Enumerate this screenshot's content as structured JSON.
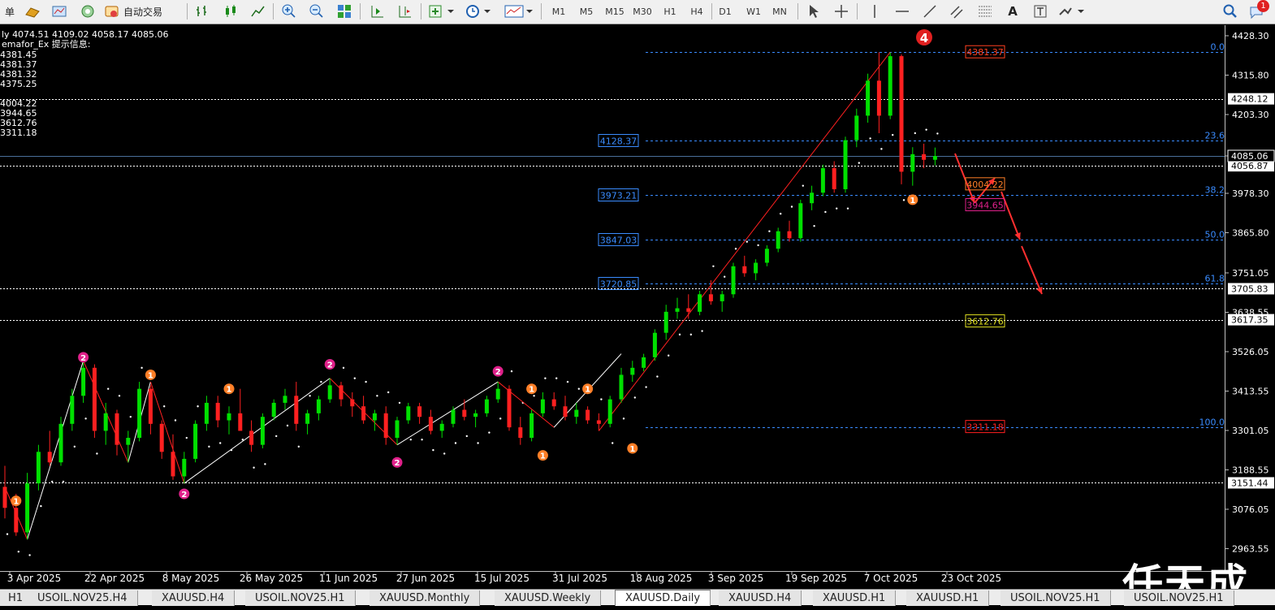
{
  "toolbar": {
    "menu_label": "单",
    "autotrade_label": "自动交易",
    "timeframes": [
      "M1",
      "M5",
      "M15",
      "M30",
      "H1",
      "H4",
      "D1",
      "W1",
      "MN"
    ],
    "text_tool_label": "A",
    "notification_count": "1"
  },
  "info": {
    "ohlc": "ly  4074.51 4109.02 4058.17 4085.06",
    "indicator_title": "emafor_Ex 提示信息:",
    "values": [
      "4381.45",
      "4381.37",
      "4381.32",
      "4375.25",
      "",
      "4004.22",
      "3944.65",
      "3612.76",
      "3311.18"
    ]
  },
  "colors": {
    "up": "#00e000",
    "down": "#ff2020",
    "fib": "#3a8cff",
    "dots": "#ffffff",
    "zigzag_up": "#ffffff",
    "zigzag_down": "#ff2020",
    "marker_orange": "#ff7f27",
    "marker_magenta": "#e0208a"
  },
  "chart_data": {
    "type": "candlestick",
    "symbol": "XAUUSD",
    "timeframe": "Daily",
    "y_range": [
      3060,
      4460
    ],
    "price_axis": [
      "4428.30",
      "4315.80",
      "4203.30",
      "4085.06",
      "3978.30",
      "3865.80",
      "3751.05",
      "3638.55",
      "3526.05",
      "3413.55",
      "3301.05",
      "3188.55",
      "3076.05",
      "2963.55"
    ],
    "hline_labels": [
      "4248.12",
      "4056.87",
      "3705.83",
      "3617.35",
      "3151.44"
    ],
    "dates": [
      "3 Apr 2025",
      "22 Apr 2025",
      "8 May 2025",
      "26 May 2025",
      "11 Jun 2025",
      "27 Jun 2025",
      "15 Jul 2025",
      "31 Jul 2025",
      "18 Aug 2025",
      "3 Sep 2025",
      "19 Sep 2025",
      "7 Oct 2025",
      "23 Oct 2025"
    ],
    "candles": [
      [
        3140,
        3200,
        3050,
        3080
      ],
      [
        3080,
        3120,
        3000,
        3010
      ],
      [
        3010,
        3180,
        2990,
        3150
      ],
      [
        3150,
        3260,
        3130,
        3240
      ],
      [
        3240,
        3300,
        3200,
        3210
      ],
      [
        3210,
        3340,
        3200,
        3320
      ],
      [
        3320,
        3420,
        3300,
        3400
      ],
      [
        3400,
        3500,
        3380,
        3480
      ],
      [
        3480,
        3490,
        3280,
        3300
      ],
      [
        3300,
        3380,
        3260,
        3350
      ],
      [
        3350,
        3360,
        3230,
        3260
      ],
      [
        3260,
        3300,
        3210,
        3280
      ],
      [
        3280,
        3440,
        3270,
        3420
      ],
      [
        3420,
        3430,
        3290,
        3320
      ],
      [
        3320,
        3330,
        3220,
        3240
      ],
      [
        3240,
        3290,
        3160,
        3170
      ],
      [
        3170,
        3240,
        3150,
        3220
      ],
      [
        3220,
        3330,
        3210,
        3320
      ],
      [
        3320,
        3400,
        3300,
        3380
      ],
      [
        3380,
        3400,
        3310,
        3330
      ],
      [
        3330,
        3370,
        3290,
        3350
      ],
      [
        3350,
        3420,
        3320,
        3300
      ],
      [
        3300,
        3330,
        3240,
        3260
      ],
      [
        3260,
        3350,
        3250,
        3340
      ],
      [
        3340,
        3390,
        3330,
        3380
      ],
      [
        3380,
        3420,
        3360,
        3400
      ],
      [
        3400,
        3440,
        3300,
        3320
      ],
      [
        3320,
        3360,
        3290,
        3350
      ],
      [
        3350,
        3400,
        3330,
        3390
      ],
      [
        3390,
        3450,
        3380,
        3430
      ],
      [
        3430,
        3440,
        3370,
        3390
      ],
      [
        3390,
        3410,
        3340,
        3370
      ],
      [
        3370,
        3400,
        3320,
        3330
      ],
      [
        3330,
        3360,
        3300,
        3350
      ],
      [
        3350,
        3370,
        3260,
        3280
      ],
      [
        3280,
        3340,
        3260,
        3330
      ],
      [
        3330,
        3380,
        3320,
        3370
      ],
      [
        3370,
        3380,
        3320,
        3340
      ],
      [
        3340,
        3360,
        3290,
        3300
      ],
      [
        3300,
        3330,
        3280,
        3320
      ],
      [
        3320,
        3370,
        3310,
        3360
      ],
      [
        3360,
        3390,
        3330,
        3340
      ],
      [
        3340,
        3360,
        3310,
        3350
      ],
      [
        3350,
        3400,
        3340,
        3390
      ],
      [
        3390,
        3440,
        3380,
        3420
      ],
      [
        3420,
        3430,
        3300,
        3310
      ],
      [
        3310,
        3340,
        3260,
        3280
      ],
      [
        3280,
        3360,
        3270,
        3350
      ],
      [
        3350,
        3410,
        3340,
        3390
      ],
      [
        3390,
        3410,
        3360,
        3370
      ],
      [
        3370,
        3400,
        3330,
        3340
      ],
      [
        3340,
        3380,
        3320,
        3360
      ],
      [
        3360,
        3370,
        3320,
        3330
      ],
      [
        3330,
        3350,
        3300,
        3320
      ],
      [
        3320,
        3400,
        3310,
        3390
      ],
      [
        3390,
        3480,
        3380,
        3460
      ],
      [
        3460,
        3500,
        3440,
        3480
      ],
      [
        3480,
        3520,
        3470,
        3510
      ],
      [
        3510,
        3590,
        3500,
        3580
      ],
      [
        3580,
        3660,
        3560,
        3640
      ],
      [
        3640,
        3680,
        3620,
        3650
      ],
      [
        3650,
        3690,
        3620,
        3640
      ],
      [
        3640,
        3700,
        3630,
        3690
      ],
      [
        3690,
        3730,
        3660,
        3670
      ],
      [
        3670,
        3700,
        3640,
        3690
      ],
      [
        3690,
        3780,
        3680,
        3770
      ],
      [
        3770,
        3800,
        3740,
        3750
      ],
      [
        3750,
        3790,
        3730,
        3780
      ],
      [
        3780,
        3830,
        3770,
        3820
      ],
      [
        3820,
        3880,
        3810,
        3870
      ],
      [
        3870,
        3900,
        3840,
        3850
      ],
      [
        3850,
        3960,
        3840,
        3950
      ],
      [
        3950,
        4000,
        3930,
        3980
      ],
      [
        3980,
        4060,
        3970,
        4050
      ],
      [
        4050,
        4070,
        3980,
        3990
      ],
      [
        3990,
        4140,
        3980,
        4130
      ],
      [
        4130,
        4220,
        4110,
        4200
      ],
      [
        4200,
        4320,
        4180,
        4300
      ],
      [
        4300,
        4381,
        4150,
        4200
      ],
      [
        4200,
        4380,
        4190,
        4370
      ],
      [
        4370,
        4375,
        4004,
        4040
      ],
      [
        4040,
        4110,
        4000,
        4090
      ],
      [
        4090,
        4120,
        4050,
        4074
      ],
      [
        4074,
        4109,
        4058,
        4085
      ]
    ],
    "fibonacci": [
      {
        "level": "0.0",
        "price": 4381.45
      },
      {
        "level": "23.6",
        "price_label": "4128.37",
        "price": 4128.37
      },
      {
        "level": "38.2",
        "price_label": "3973.21",
        "price": 3973.21
      },
      {
        "level": "50.0",
        "price_label": "3847.03",
        "price": 3847.03
      },
      {
        "level": "61.8",
        "price_label": "3720.85",
        "price": 3720.85
      },
      {
        "level": "100.0",
        "price": 3311.18
      }
    ],
    "box_labels": [
      "4381.37",
      "4004.22",
      "3944.65",
      "3612.76",
      "3311.18"
    ],
    "wave_label": "4"
  },
  "tabs": [
    "H1",
    "USOIL.NOV25.H4",
    "XAUUSD.H4",
    "USOIL.NOV25.H1",
    "XAUUSD.Monthly",
    "XAUUSD.Weekly",
    "XAUUSD.Daily",
    "XAUUSD.H4",
    "XAUUSD.H1",
    "XAUUSD.H1",
    "USOIL.NOV25.H1",
    "USOIL.NOV25.H1"
  ],
  "active_tab": "XAUUSD.Daily",
  "watermark": "任天成"
}
